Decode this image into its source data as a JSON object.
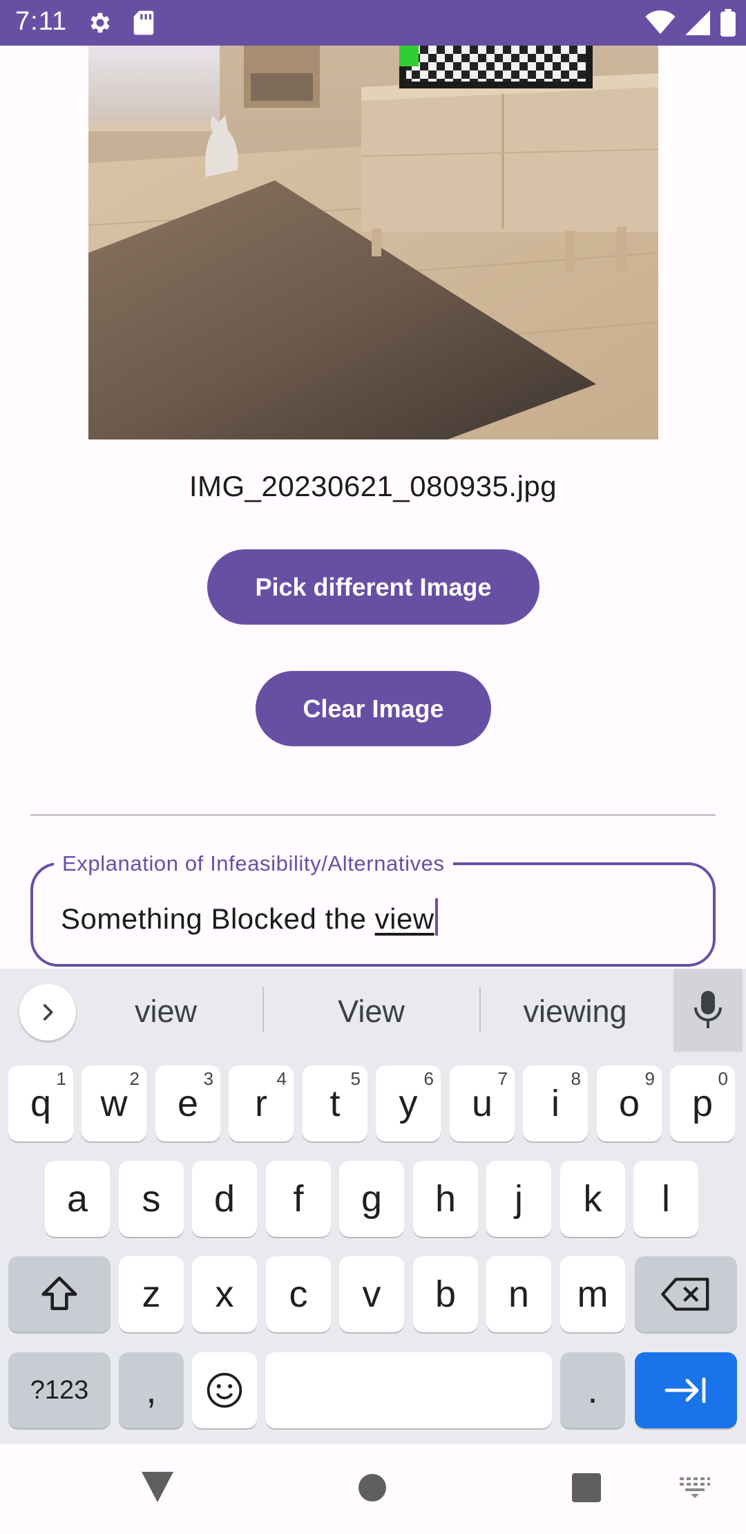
{
  "status_bar": {
    "time": "7:11",
    "icons": [
      "gear-icon",
      "sd-card-icon",
      "wifi-icon",
      "signal-icon",
      "battery-icon"
    ]
  },
  "image": {
    "filename": "IMG_20230621_080935.jpg"
  },
  "buttons": {
    "pick_label": "Pick different Image",
    "clear_label": "Clear Image"
  },
  "field": {
    "label": "Explanation of Infeasibility/Alternatives",
    "value_prefix": "Something Blocked the ",
    "value_word": "view"
  },
  "keyboard": {
    "suggestions": [
      "view",
      "View",
      "viewing"
    ],
    "row1": [
      {
        "k": "q",
        "h": "1"
      },
      {
        "k": "w",
        "h": "2"
      },
      {
        "k": "e",
        "h": "3"
      },
      {
        "k": "r",
        "h": "4"
      },
      {
        "k": "t",
        "h": "5"
      },
      {
        "k": "y",
        "h": "6"
      },
      {
        "k": "u",
        "h": "7"
      },
      {
        "k": "i",
        "h": "8"
      },
      {
        "k": "o",
        "h": "9"
      },
      {
        "k": "p",
        "h": "0"
      }
    ],
    "row2": [
      "a",
      "s",
      "d",
      "f",
      "g",
      "h",
      "j",
      "k",
      "l"
    ],
    "row3": [
      "z",
      "x",
      "c",
      "v",
      "b",
      "n",
      "m"
    ],
    "symbols_label": "?123",
    "comma": ",",
    "period": ".",
    "colors": {
      "background": "#e9eaef",
      "action": "#1a73e8"
    }
  },
  "colors": {
    "primary": "#6750a4",
    "background": "#fffbfe"
  }
}
